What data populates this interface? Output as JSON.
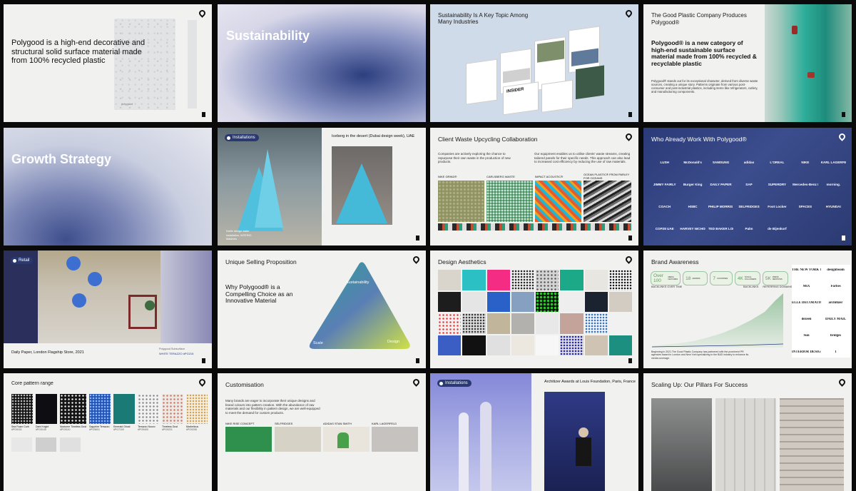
{
  "slides": {
    "s1": {
      "headline": "Polygood is a high-end decorative and structural solid surface material made from 100% recycled plastic",
      "panel_text": "polygood"
    },
    "s2": {
      "headline": "Sustainability"
    },
    "s3": {
      "title": "Sustainability Is A Key Topic Among Many Industries",
      "card_brand": "INSIDER"
    },
    "s4": {
      "title": "The Good Plastic Company Produces Polygood®",
      "headline": "Polygood® is a new category of high-end sustainable surface material made from 100% recycled & recyclable plastic",
      "body": "Polygood® stands out for its exceptional character, derived from diverse waste sources, creating a unique story. Patterns originate from various post-consumer and post-industrial plastics, including items like refrigerators, cutlery, and manufacturing components."
    },
    "s5": {
      "headline": "Growth Strategy"
    },
    "s6": {
      "tag": "Installations",
      "caption": "Iceberg in the desert (Dubai design week), UAE",
      "small_note": "Noble design water installation, INTERIO Maldives"
    },
    "s7": {
      "title": "Client Waste Upcycling Collaboration",
      "intro_left": "Companies are actively exploring the chance to repurpose their own waste in the production of new products.",
      "intro_right": "Our equipment enables us to utilise clients' waste streams, creating tailored panels for their specific needs. This approach can also lead to increased cost efficiency by reducing the use of raw materials.",
      "labels": [
        "NIKE GRIND®",
        "CARLSBERG WASTE",
        "IMPACT ACOUSTIC®",
        "OCEAN PLASTIC® FROM PARLEY FOR OCEANS"
      ]
    },
    "s8": {
      "title": "Who Already Work With Polygood®",
      "brands": [
        "LUSH",
        "McDonald's",
        "SAMSUNG",
        "adidas",
        "L'OREAL",
        "NIKE",
        "KARL LAGERFELD",
        "JIMMY FAIRLY",
        "Burger King",
        "DAILY PAPER",
        "SAP",
        "SUPERDRY",
        "Mercedes-Benz Fashion Week",
        "morning.",
        "COACH",
        "HSBC",
        "PHILIP MORRIS INTERNATIONAL",
        "SELFRIDGES",
        "Foot Locker",
        "SPACES",
        "HYUNDAI",
        "COP28 UAE",
        "HARVEY NICHOLS",
        "TED BAKER LONDON",
        "Palm",
        "de Bijenkorf"
      ]
    },
    "s9": {
      "tag": "Retail",
      "caption": "Daily Paper, London Flagship Store, 2021",
      "material_label": "Polygood Subsurface",
      "material_name": "WHITE TERAZZO #PG215"
    },
    "s10": {
      "title": "Unique Selling Proposition",
      "headline": "Why Polygood® is a Compelling Choice as an Innovative Material",
      "tri_top": "Sustainability",
      "tri_left": "Scale",
      "tri_right": "Design"
    },
    "s11": {
      "title": "Design Aesthetics"
    },
    "s12": {
      "title": "Brand Awareness",
      "stats": [
        {
          "value": "Over 100",
          "label": "MEDIA FEATURES"
        },
        {
          "value": "18",
          "label": "AWARDS"
        },
        {
          "value": "7",
          "label": "COUNTRIES"
        },
        {
          "value": "4K",
          "label": "SOCIAL FOLLOWERS"
        },
        {
          "value": "5K",
          "label": "PRESS MENTIONS"
        }
      ],
      "chart_title": "BACKLINKS OVER TIME",
      "legend": [
        "BACKLINKS",
        "REFERRING DOMAINS"
      ],
      "footnote": "Beginning in 2021 The Good Plastic Company has partnered with the prominent PR agencies based in London and New York specializing in the B&D industry to enhance its media coverage.",
      "press": [
        "THE NEW YORK TIMES",
        "designboom",
        "MIX",
        "Forbes",
        "ELLE DECORATION",
        "architizer",
        "dezeen",
        "DAILY MAIL",
        "Sun",
        "bridges",
        "INTERIOR DESIGN",
        "1"
      ]
    },
    "s13": {
      "title": "Core pattern range",
      "swatches": [
        {
          "name": "Sea Foam Curb",
          "code": "#PG9101"
        },
        {
          "name": "Dark Knight",
          "code": "#PG9105"
        },
        {
          "name": "Nocturne Timeless Dust",
          "code": "#PG9110"
        },
        {
          "name": "Sapphire Terrazzo",
          "code": "#PG9601"
        },
        {
          "name": "Emerald Ghost",
          "code": "#PG7100"
        },
        {
          "name": "Terrazzo Nuovo",
          "code": "#PG9400"
        },
        {
          "name": "Timeless Dust",
          "code": "#PG9221"
        },
        {
          "name": "Marbellous",
          "code": "#PG9208"
        }
      ]
    },
    "s14": {
      "title": "Customisation",
      "intro": "Many brands are eager to incorporate their unique designs and brand colours into pattern creation. With the abundance of raw materials and our flexibility in pattern design, we are well-equipped to meet the demand for custom products.",
      "labels": [
        "NIKE RISE CONCEPT",
        "SELFRIDGES",
        "ADIDAS STAN SMITH",
        "KARL LAGERFELD"
      ]
    },
    "s15": {
      "tag": "Installations",
      "caption": "Architizer Awards at Louis Foundation, Paris, France"
    },
    "s16": {
      "title": "Scaling Up: Our Pillars For Success"
    }
  },
  "colors": {
    "navy": "#1f2d63",
    "accent_blue": "#3b4d8f",
    "teal": "#2fae9b",
    "green_chart": "#9bc5a3"
  }
}
